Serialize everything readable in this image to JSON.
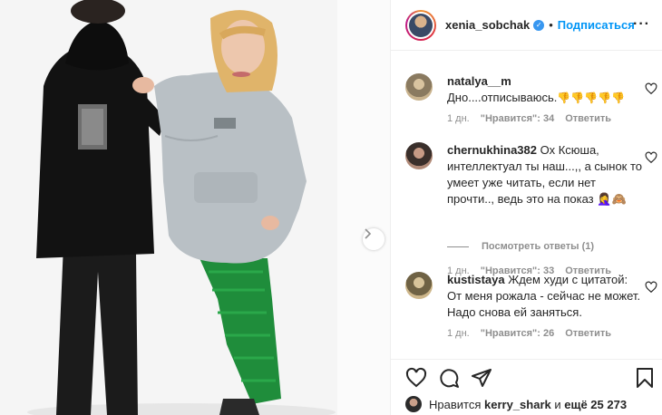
{
  "post": {
    "username": "xenia_sobchak",
    "follow_label": "Подписаться",
    "separator": "•"
  },
  "comments": [
    {
      "user": "natalya__m",
      "text": "Дно....отписываюсь.",
      "emoji": "👎👎👎👎👎",
      "age": "1 дн.",
      "likes": "\"Нравится\": 34",
      "reply": "Ответить"
    },
    {
      "user": "chernukhina382",
      "text": "Ох Ксюша, интеллектуал ты наш...,, а сынок то умеет уже читать, если нет прочти.., ведь это на показ",
      "emoji": "🤦‍♀️🙈",
      "age": "1 дн.",
      "likes": "\"Нравится\": 33",
      "reply": "Ответить"
    },
    {
      "user": "kustistaya",
      "text": "Ждем худи с цитатой: От меня рожала - сейчас не может. Надо снова ей заняться.",
      "emoji": "",
      "age": "1 дн.",
      "likes": "\"Нравится\": 26",
      "reply": "Ответить"
    }
  ],
  "view_replies": "Посмотреть ответы (1)",
  "liked_by": {
    "prefix": "Нравится",
    "user": "kerry_shark",
    "suffix_pre": "и",
    "suffix": "ещё 25 273"
  },
  "icons": [
    "verified-badge-icon",
    "more-icon",
    "heart-icon",
    "comment-icon",
    "share-icon",
    "bookmark-icon",
    "chevron-right-icon"
  ],
  "colors": {
    "accent": "#0095f6",
    "muted": "#8e8e8e",
    "text": "#262626",
    "border": "#efefef"
  }
}
